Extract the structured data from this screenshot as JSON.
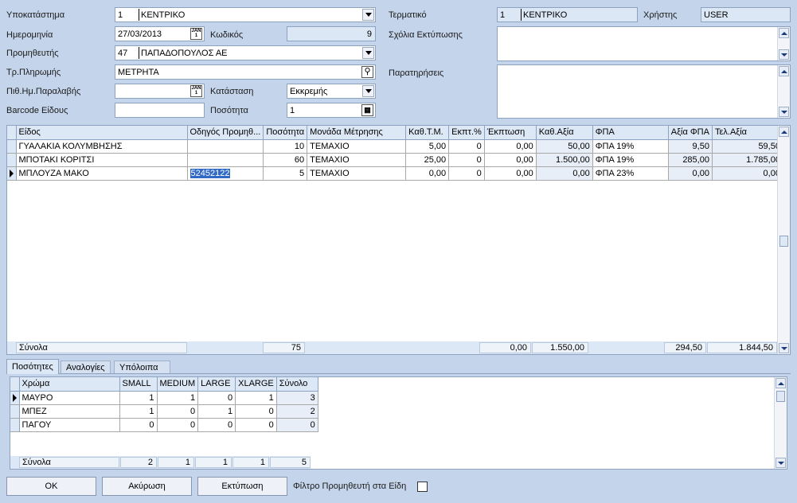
{
  "header": {
    "branch_label": "Υποκατάστημα",
    "branch_code": "1",
    "branch_name": "ΚΕΝΤΡΙΚΟ",
    "date_label": "Ημερομηνία",
    "date_value": "27/03/2013",
    "code_label": "Κωδικός",
    "code_value": "9",
    "supplier_label": "Προμηθευτής",
    "supplier_code": "47",
    "supplier_name": "ΠΑΠΑΔΟΠΟΥΛΟΣ ΑΕ",
    "payment_label": "Τρ.Πληρωμής",
    "payment_value": "ΜΕΤΡΗΤΑ",
    "probable_date_label": "Πιθ.Ημ.Παραλαβής",
    "probable_date_value": "",
    "status_label": "Κατάσταση",
    "status_value": "Εκκρεμής",
    "barcode_label": "Barcode Είδους",
    "barcode_value": "",
    "qty_label": "Ποσότητα",
    "qty_value": "1",
    "terminal_label": "Τερματικό",
    "terminal_code": "1",
    "terminal_name": "ΚΕΝΤΡΙΚΟ",
    "user_label": "Χρήστης",
    "user_value": "USER",
    "print_comments_label": "Σχόλια Εκτύπωσης",
    "remarks_label": "Παρατηρήσεις",
    "date_icon": "calendar-icon",
    "qty_icon": "calculator-icon",
    "payment_icon": "lookup-icon"
  },
  "items_grid": {
    "columns": [
      "Είδος",
      "Οδηγός Προμηθ...",
      "Ποσότητα",
      "Μονάδα Μέτρησης",
      "Καθ.Τ.Μ.",
      "Εκπτ.%",
      "Έκπτωση",
      "Καθ.Αξία",
      "ΦΠΑ",
      "Αξία ΦΠΑ",
      "Τελ.Αξία"
    ],
    "rows": [
      [
        "ΓΥΑΛΑΚΙΑ ΚΟΛΥΜΒΗΣΗΣ",
        "",
        "10",
        "ΤΕΜΑΧΙΟ",
        "5,00",
        "0",
        "0,00",
        "50,00",
        "ΦΠΑ 19%",
        "9,50",
        "59,50"
      ],
      [
        "ΜΠΟΤΑΚΙ ΚΟΡΙΤΣΙ",
        "",
        "60",
        "ΤΕΜΑΧΙΟ",
        "25,00",
        "0",
        "0,00",
        "1.500,00",
        "ΦΠΑ 19%",
        "285,00",
        "1.785,00"
      ],
      [
        "ΜΠΛΟΥΖΑ ΜΑΚΟ",
        "52452122",
        "5",
        "ΤΕΜΑΧΙΟ",
        "0,00",
        "0",
        "0,00",
        "0,00",
        "ΦΠΑ 23%",
        "0,00",
        "0,00"
      ]
    ],
    "totals": {
      "label": "Σύνολα",
      "qty": "75",
      "discount": "0,00",
      "net": "1.550,00",
      "vat": "294,50",
      "total": "1.844,50"
    }
  },
  "tabs": [
    "Ποσότητες",
    "Αναλογίες",
    "Υπόλοιπα"
  ],
  "size_grid": {
    "columns": [
      "Χρώμα",
      "SMALL",
      "MEDIUM",
      "LARGE",
      "XLARGE",
      "Σύνολο"
    ],
    "rows": [
      [
        "ΜΑΥΡΟ",
        "1",
        "1",
        "0",
        "1",
        "3"
      ],
      [
        "ΜΠΕΖ",
        "1",
        "0",
        "1",
        "0",
        "2"
      ],
      [
        "ΠΑΓΟΥ",
        "0",
        "0",
        "0",
        "0",
        "0"
      ]
    ],
    "totals": {
      "label": "Σύνολα",
      "values": [
        "2",
        "1",
        "1",
        "1",
        "5"
      ]
    }
  },
  "buttons": {
    "ok": "OK",
    "cancel": "Ακύρωση",
    "print": "Εκτύπωση",
    "filter_label": "Φίλτρο Προμηθευτή στα Είδη"
  },
  "colors": {
    "background": "#c4d4ea",
    "selection": "#316ac5",
    "header": "#dde8f6"
  }
}
